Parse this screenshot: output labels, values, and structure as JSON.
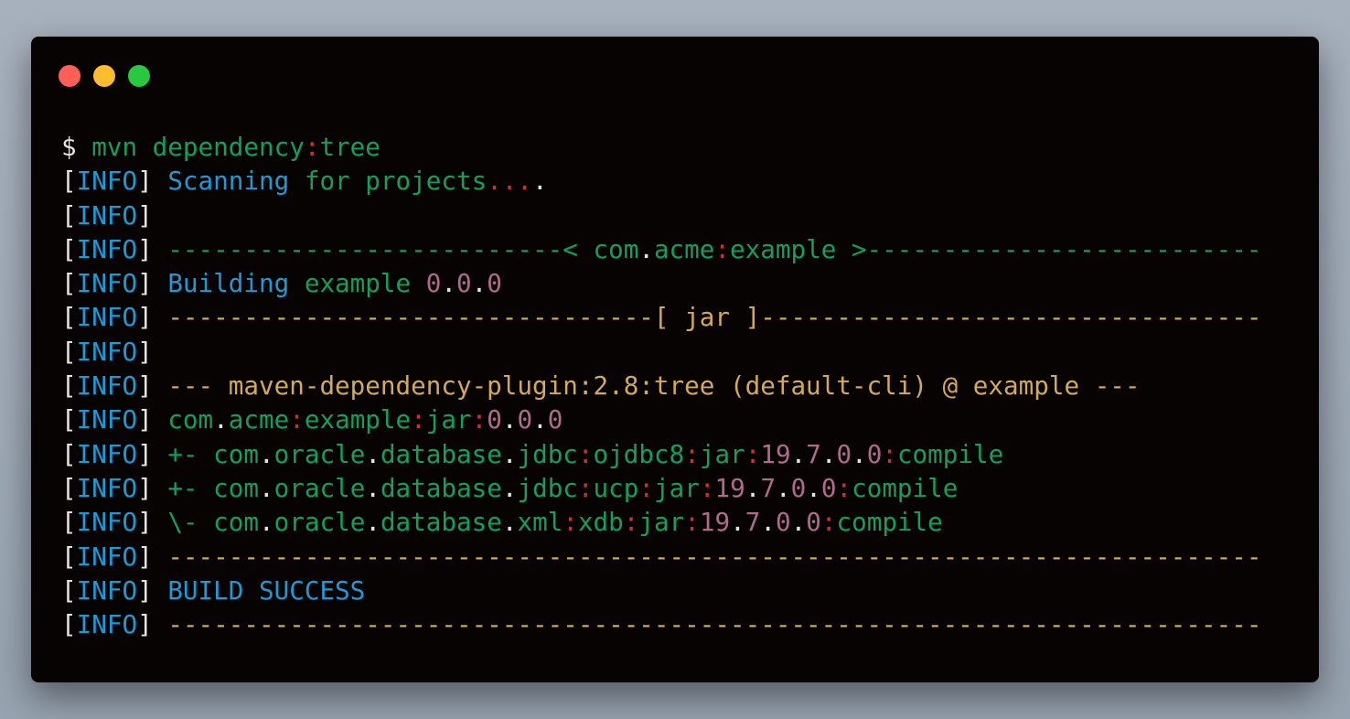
{
  "window": {
    "controls": [
      {
        "name": "close-button",
        "color": "#ff5f57"
      },
      {
        "name": "minimize-button",
        "color": "#febc2e"
      },
      {
        "name": "maximize-button",
        "color": "#28c840"
      }
    ]
  },
  "colors": {
    "w": "#e4e4e4",
    "b": "#1e9ad6",
    "g": "#12a05a",
    "r": "#d12f2f",
    "m": "#b06b8c",
    "y": "#d3a95a"
  },
  "terminal": {
    "lines": [
      [
        [
          "w",
          "$ "
        ],
        [
          "g",
          "mvn dependency"
        ],
        [
          "r",
          ":"
        ],
        [
          "g",
          "tree"
        ]
      ],
      [
        [
          "w",
          "["
        ],
        [
          "b",
          "INFO"
        ],
        [
          "w",
          "] "
        ],
        [
          "b",
          "Scanning "
        ],
        [
          "g",
          "for projects"
        ],
        [
          "r",
          "..."
        ],
        [
          "w",
          "."
        ]
      ],
      [
        [
          "w",
          "["
        ],
        [
          "b",
          "INFO"
        ],
        [
          "w",
          "]"
        ]
      ],
      [
        [
          "w",
          "["
        ],
        [
          "b",
          "INFO"
        ],
        [
          "w",
          "] "
        ],
        [
          "g",
          "--------------------------< com"
        ],
        [
          "w",
          "."
        ],
        [
          "g",
          "acme"
        ],
        [
          "r",
          ":"
        ],
        [
          "g",
          "example >--------------------------"
        ]
      ],
      [
        [
          "w",
          "["
        ],
        [
          "b",
          "INFO"
        ],
        [
          "w",
          "] "
        ],
        [
          "b",
          "Building "
        ],
        [
          "g",
          "example "
        ],
        [
          "m",
          "0"
        ],
        [
          "w",
          "."
        ],
        [
          "m",
          "0"
        ],
        [
          "w",
          "."
        ],
        [
          "m",
          "0"
        ]
      ],
      [
        [
          "w",
          "["
        ],
        [
          "b",
          "INFO"
        ],
        [
          "w",
          "] "
        ],
        [
          "y",
          "--------------------------------[ jar ]---------------------------------"
        ]
      ],
      [
        [
          "w",
          "["
        ],
        [
          "b",
          "INFO"
        ],
        [
          "w",
          "]"
        ]
      ],
      [
        [
          "w",
          "["
        ],
        [
          "b",
          "INFO"
        ],
        [
          "w",
          "] "
        ],
        [
          "y",
          "--- maven-dependency-plugin:2.8:tree (default-cli) @ example ---"
        ]
      ],
      [
        [
          "w",
          "["
        ],
        [
          "b",
          "INFO"
        ],
        [
          "w",
          "] "
        ],
        [
          "g",
          "com"
        ],
        [
          "w",
          "."
        ],
        [
          "g",
          "acme"
        ],
        [
          "r",
          ":"
        ],
        [
          "g",
          "example"
        ],
        [
          "r",
          ":"
        ],
        [
          "g",
          "jar"
        ],
        [
          "r",
          ":"
        ],
        [
          "m",
          "0"
        ],
        [
          "w",
          "."
        ],
        [
          "m",
          "0"
        ],
        [
          "w",
          "."
        ],
        [
          "m",
          "0"
        ]
      ],
      [
        [
          "w",
          "["
        ],
        [
          "b",
          "INFO"
        ],
        [
          "w",
          "] "
        ],
        [
          "g",
          "+- com"
        ],
        [
          "w",
          "."
        ],
        [
          "g",
          "oracle"
        ],
        [
          "w",
          "."
        ],
        [
          "g",
          "database"
        ],
        [
          "w",
          "."
        ],
        [
          "g",
          "jdbc"
        ],
        [
          "r",
          ":"
        ],
        [
          "g",
          "ojdbc8"
        ],
        [
          "r",
          ":"
        ],
        [
          "g",
          "jar"
        ],
        [
          "r",
          ":"
        ],
        [
          "m",
          "19"
        ],
        [
          "w",
          "."
        ],
        [
          "m",
          "7"
        ],
        [
          "w",
          "."
        ],
        [
          "m",
          "0"
        ],
        [
          "w",
          "."
        ],
        [
          "m",
          "0"
        ],
        [
          "r",
          ":"
        ],
        [
          "g",
          "compile"
        ]
      ],
      [
        [
          "w",
          "["
        ],
        [
          "b",
          "INFO"
        ],
        [
          "w",
          "] "
        ],
        [
          "g",
          "+- com"
        ],
        [
          "w",
          "."
        ],
        [
          "g",
          "oracle"
        ],
        [
          "w",
          "."
        ],
        [
          "g",
          "database"
        ],
        [
          "w",
          "."
        ],
        [
          "g",
          "jdbc"
        ],
        [
          "r",
          ":"
        ],
        [
          "g",
          "ucp"
        ],
        [
          "r",
          ":"
        ],
        [
          "g",
          "jar"
        ],
        [
          "r",
          ":"
        ],
        [
          "m",
          "19"
        ],
        [
          "w",
          "."
        ],
        [
          "m",
          "7"
        ],
        [
          "w",
          "."
        ],
        [
          "m",
          "0"
        ],
        [
          "w",
          "."
        ],
        [
          "m",
          "0"
        ],
        [
          "r",
          ":"
        ],
        [
          "g",
          "compile"
        ]
      ],
      [
        [
          "w",
          "["
        ],
        [
          "b",
          "INFO"
        ],
        [
          "w",
          "] "
        ],
        [
          "g",
          "\\- com"
        ],
        [
          "w",
          "."
        ],
        [
          "g",
          "oracle"
        ],
        [
          "w",
          "."
        ],
        [
          "g",
          "database"
        ],
        [
          "w",
          "."
        ],
        [
          "g",
          "xml"
        ],
        [
          "r",
          ":"
        ],
        [
          "g",
          "xdb"
        ],
        [
          "r",
          ":"
        ],
        [
          "g",
          "jar"
        ],
        [
          "r",
          ":"
        ],
        [
          "m",
          "19"
        ],
        [
          "w",
          "."
        ],
        [
          "m",
          "7"
        ],
        [
          "w",
          "."
        ],
        [
          "m",
          "0"
        ],
        [
          "w",
          "."
        ],
        [
          "m",
          "0"
        ],
        [
          "r",
          ":"
        ],
        [
          "g",
          "compile"
        ]
      ],
      [
        [
          "w",
          "["
        ],
        [
          "b",
          "INFO"
        ],
        [
          "w",
          "] "
        ],
        [
          "y",
          "------------------------------------------------------------------------"
        ]
      ],
      [
        [
          "w",
          "["
        ],
        [
          "b",
          "INFO"
        ],
        [
          "w",
          "] "
        ],
        [
          "b",
          "BUILD SUCCESS"
        ]
      ],
      [
        [
          "w",
          "["
        ],
        [
          "b",
          "INFO"
        ],
        [
          "w",
          "] "
        ],
        [
          "y",
          "------------------------------------------------------------------------"
        ]
      ]
    ]
  }
}
